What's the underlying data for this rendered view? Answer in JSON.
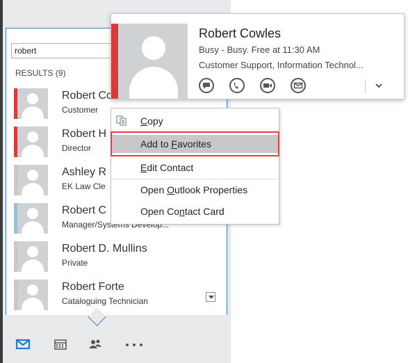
{
  "search": {
    "value": "robert"
  },
  "results_label": "RESULTS (9)",
  "results": [
    {
      "name": "Robert Cowles",
      "sub": "Customer",
      "status_color": "#cc3333",
      "striped": true
    },
    {
      "name": "Robert H",
      "sub": "Director",
      "status_color": "#cc3333",
      "striped": true
    },
    {
      "name": "Ashley R",
      "sub": "EK Law Cle",
      "status_color": "#c8c8c8",
      "striped": false
    },
    {
      "name": "Robert C",
      "sub": "Manager/Systems Develop...",
      "status_color": "#9dbfd6",
      "striped": false
    },
    {
      "name": "Robert D. Mullins",
      "sub": "Private",
      "status_color": "#c8c8c8",
      "striped": false
    },
    {
      "name": "Robert Forte",
      "sub": "Cataloguing Technician",
      "status_color": "#c8c8c8",
      "striped": false
    }
  ],
  "card": {
    "name": "Robert Cowles",
    "status": "Busy - Busy.  Free at 11:30 AM",
    "department": "Customer Support, Information Technol...",
    "actions": [
      "im-icon",
      "phone-icon",
      "video-icon",
      "email-icon"
    ],
    "status_color": "#cc3333"
  },
  "menu": {
    "copy": {
      "pre": "",
      "ul": "C",
      "post": "opy"
    },
    "add_favorites": {
      "pre": "Add to ",
      "ul": "F",
      "post": "avorites"
    },
    "edit_contact": {
      "pre": "",
      "ul": "E",
      "post": "dit Contact"
    },
    "open_outlook": {
      "pre": "Open ",
      "ul": "O",
      "post": "utlook Properties"
    },
    "open_card": {
      "pre": "Open Co",
      "ul": "n",
      "post": "tact Card"
    }
  },
  "nav": [
    "mail-icon",
    "calendar-icon",
    "contacts-icon",
    "more-icon"
  ],
  "colors": {
    "accent": "#1f7ad8",
    "highlight_border": "#e04040",
    "busy": "#cc3333"
  }
}
